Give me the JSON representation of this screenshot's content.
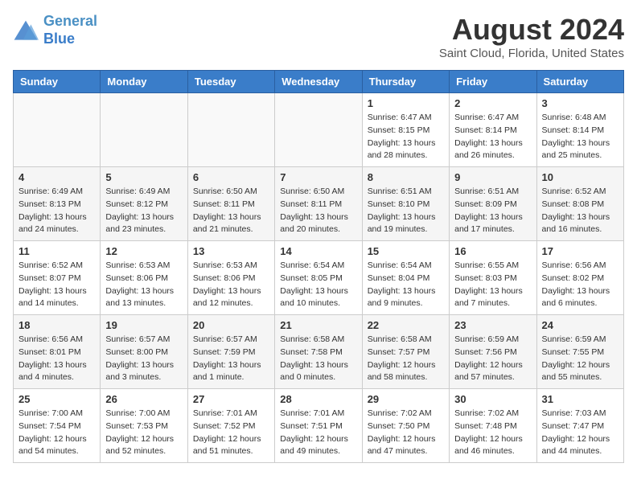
{
  "header": {
    "logo_line1": "General",
    "logo_line2": "Blue",
    "title": "August 2024",
    "subtitle": "Saint Cloud, Florida, United States"
  },
  "days_of_week": [
    "Sunday",
    "Monday",
    "Tuesday",
    "Wednesday",
    "Thursday",
    "Friday",
    "Saturday"
  ],
  "weeks": [
    [
      {
        "day": "",
        "info": ""
      },
      {
        "day": "",
        "info": ""
      },
      {
        "day": "",
        "info": ""
      },
      {
        "day": "",
        "info": ""
      },
      {
        "day": "1",
        "info": "Sunrise: 6:47 AM\nSunset: 8:15 PM\nDaylight: 13 hours\nand 28 minutes."
      },
      {
        "day": "2",
        "info": "Sunrise: 6:47 AM\nSunset: 8:14 PM\nDaylight: 13 hours\nand 26 minutes."
      },
      {
        "day": "3",
        "info": "Sunrise: 6:48 AM\nSunset: 8:14 PM\nDaylight: 13 hours\nand 25 minutes."
      }
    ],
    [
      {
        "day": "4",
        "info": "Sunrise: 6:49 AM\nSunset: 8:13 PM\nDaylight: 13 hours\nand 24 minutes."
      },
      {
        "day": "5",
        "info": "Sunrise: 6:49 AM\nSunset: 8:12 PM\nDaylight: 13 hours\nand 23 minutes."
      },
      {
        "day": "6",
        "info": "Sunrise: 6:50 AM\nSunset: 8:11 PM\nDaylight: 13 hours\nand 21 minutes."
      },
      {
        "day": "7",
        "info": "Sunrise: 6:50 AM\nSunset: 8:11 PM\nDaylight: 13 hours\nand 20 minutes."
      },
      {
        "day": "8",
        "info": "Sunrise: 6:51 AM\nSunset: 8:10 PM\nDaylight: 13 hours\nand 19 minutes."
      },
      {
        "day": "9",
        "info": "Sunrise: 6:51 AM\nSunset: 8:09 PM\nDaylight: 13 hours\nand 17 minutes."
      },
      {
        "day": "10",
        "info": "Sunrise: 6:52 AM\nSunset: 8:08 PM\nDaylight: 13 hours\nand 16 minutes."
      }
    ],
    [
      {
        "day": "11",
        "info": "Sunrise: 6:52 AM\nSunset: 8:07 PM\nDaylight: 13 hours\nand 14 minutes."
      },
      {
        "day": "12",
        "info": "Sunrise: 6:53 AM\nSunset: 8:06 PM\nDaylight: 13 hours\nand 13 minutes."
      },
      {
        "day": "13",
        "info": "Sunrise: 6:53 AM\nSunset: 8:06 PM\nDaylight: 13 hours\nand 12 minutes."
      },
      {
        "day": "14",
        "info": "Sunrise: 6:54 AM\nSunset: 8:05 PM\nDaylight: 13 hours\nand 10 minutes."
      },
      {
        "day": "15",
        "info": "Sunrise: 6:54 AM\nSunset: 8:04 PM\nDaylight: 13 hours\nand 9 minutes."
      },
      {
        "day": "16",
        "info": "Sunrise: 6:55 AM\nSunset: 8:03 PM\nDaylight: 13 hours\nand 7 minutes."
      },
      {
        "day": "17",
        "info": "Sunrise: 6:56 AM\nSunset: 8:02 PM\nDaylight: 13 hours\nand 6 minutes."
      }
    ],
    [
      {
        "day": "18",
        "info": "Sunrise: 6:56 AM\nSunset: 8:01 PM\nDaylight: 13 hours\nand 4 minutes."
      },
      {
        "day": "19",
        "info": "Sunrise: 6:57 AM\nSunset: 8:00 PM\nDaylight: 13 hours\nand 3 minutes."
      },
      {
        "day": "20",
        "info": "Sunrise: 6:57 AM\nSunset: 7:59 PM\nDaylight: 13 hours\nand 1 minute."
      },
      {
        "day": "21",
        "info": "Sunrise: 6:58 AM\nSunset: 7:58 PM\nDaylight: 13 hours\nand 0 minutes."
      },
      {
        "day": "22",
        "info": "Sunrise: 6:58 AM\nSunset: 7:57 PM\nDaylight: 12 hours\nand 58 minutes."
      },
      {
        "day": "23",
        "info": "Sunrise: 6:59 AM\nSunset: 7:56 PM\nDaylight: 12 hours\nand 57 minutes."
      },
      {
        "day": "24",
        "info": "Sunrise: 6:59 AM\nSunset: 7:55 PM\nDaylight: 12 hours\nand 55 minutes."
      }
    ],
    [
      {
        "day": "25",
        "info": "Sunrise: 7:00 AM\nSunset: 7:54 PM\nDaylight: 12 hours\nand 54 minutes."
      },
      {
        "day": "26",
        "info": "Sunrise: 7:00 AM\nSunset: 7:53 PM\nDaylight: 12 hours\nand 52 minutes."
      },
      {
        "day": "27",
        "info": "Sunrise: 7:01 AM\nSunset: 7:52 PM\nDaylight: 12 hours\nand 51 minutes."
      },
      {
        "day": "28",
        "info": "Sunrise: 7:01 AM\nSunset: 7:51 PM\nDaylight: 12 hours\nand 49 minutes."
      },
      {
        "day": "29",
        "info": "Sunrise: 7:02 AM\nSunset: 7:50 PM\nDaylight: 12 hours\nand 47 minutes."
      },
      {
        "day": "30",
        "info": "Sunrise: 7:02 AM\nSunset: 7:48 PM\nDaylight: 12 hours\nand 46 minutes."
      },
      {
        "day": "31",
        "info": "Sunrise: 7:03 AM\nSunset: 7:47 PM\nDaylight: 12 hours\nand 44 minutes."
      }
    ]
  ]
}
